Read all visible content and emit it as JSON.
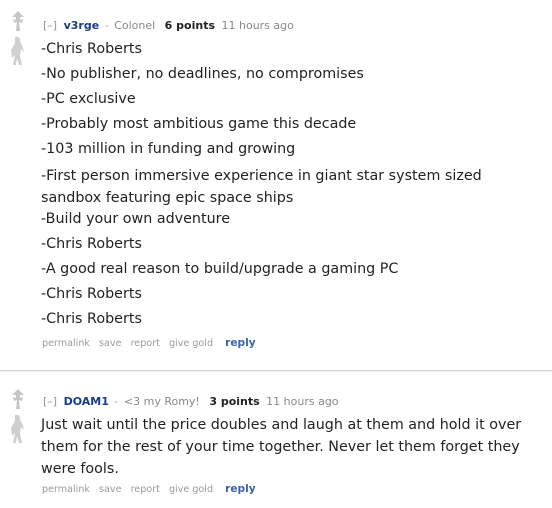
{
  "comments": [
    {
      "expand": "[–]",
      "author": "v3rge",
      "separator": "-",
      "flair": "Colonel",
      "score": "6 points",
      "time": "11 hours ago",
      "lines": [
        "-Chris Roberts",
        "-No publisher, no deadlines, no compromises",
        "-PC exclusive",
        "-Probably most ambitious game this decade",
        "-103 million in funding and growing",
        "-First person immersive experience in giant star system sized sandbox featuring epic space ships",
        "-Build your own adventure",
        "-Chris Roberts",
        "-A good real reason to build/upgrade a gaming PC",
        "-Chris Roberts",
        "-Chris Roberts"
      ],
      "buttons": {
        "permalink": "permalink",
        "save": "save",
        "report": "report",
        "give_gold": "give gold",
        "reply": "reply"
      }
    },
    {
      "expand": "[–]",
      "author": "DOAM1",
      "separator": "-",
      "flair": "<3 my Romy!",
      "score": "3 points",
      "time": "11 hours ago",
      "text": "Just wait until the price doubles and laugh at them and hold it over them for the rest of your time together. Never let them forget they were fools.",
      "buttons": {
        "permalink": "permalink",
        "save": "save",
        "report": "report",
        "give_gold": "give gold",
        "reply": "reply"
      }
    }
  ],
  "icons": {
    "upvote": "upvote-arrow-icon",
    "downvote": "downvote-arrow-icon"
  }
}
